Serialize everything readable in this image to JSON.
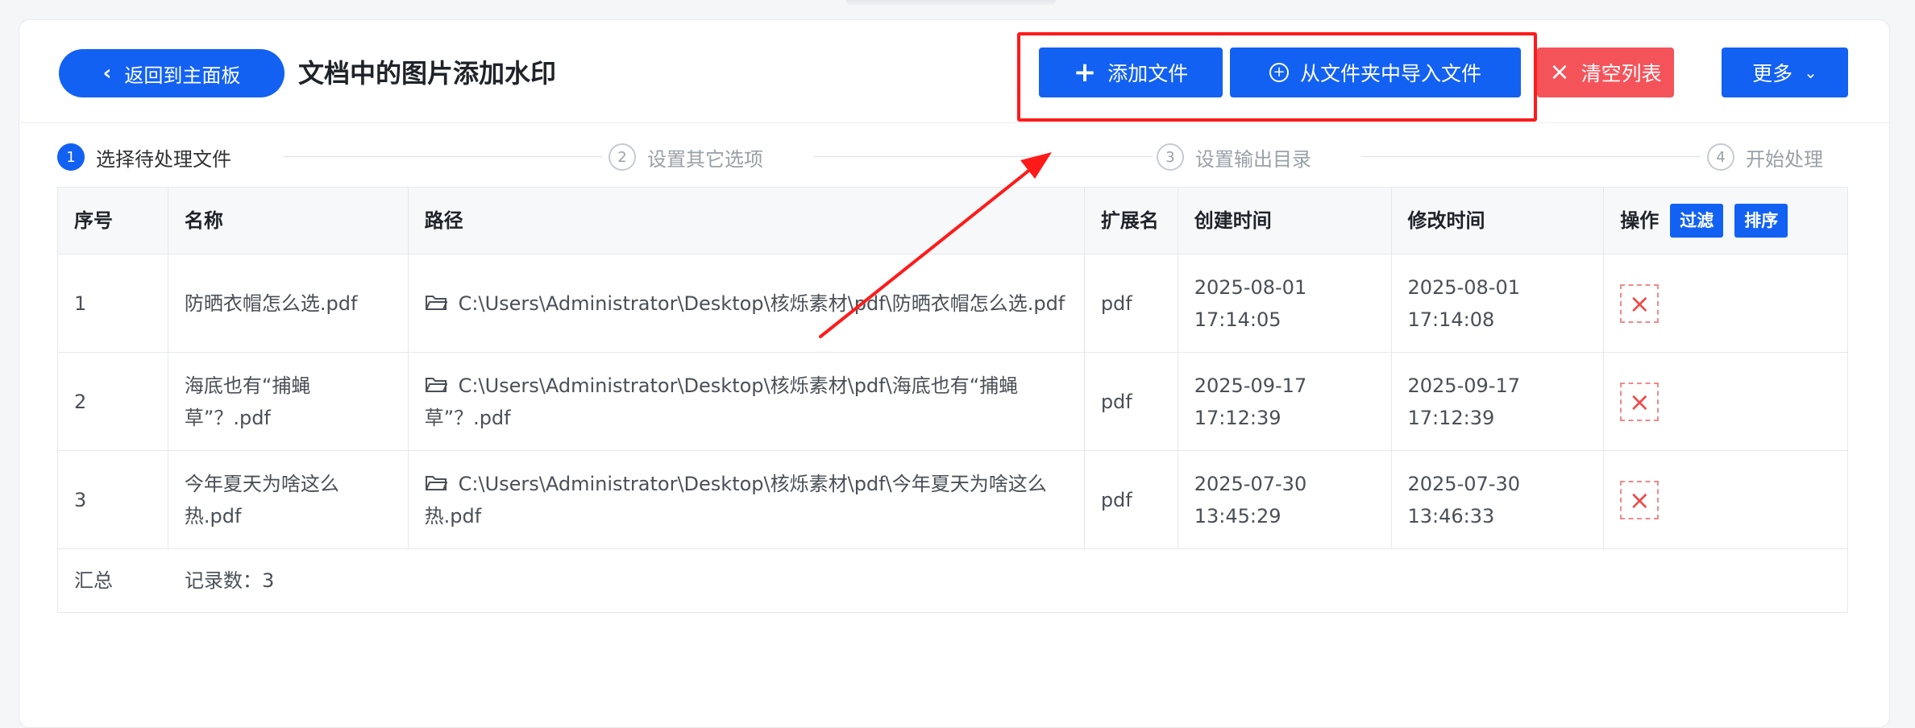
{
  "header": {
    "back_label": "返回到主面板",
    "title": "文档中的图片添加水印"
  },
  "toolbar": {
    "add_file": "添加文件",
    "import_folder": "从文件夹中导入文件",
    "clear_list": "清空列表",
    "more": "更多"
  },
  "steps": [
    {
      "num": "1",
      "label": "选择待处理文件"
    },
    {
      "num": "2",
      "label": "设置其它选项"
    },
    {
      "num": "3",
      "label": "设置输出目录"
    },
    {
      "num": "4",
      "label": "开始处理"
    }
  ],
  "table": {
    "columns": [
      "序号",
      "名称",
      "路径",
      "扩展名",
      "创建时间",
      "修改时间",
      "操作"
    ],
    "filter_label": "过滤",
    "sort_label": "排序",
    "rows": [
      {
        "index": "1",
        "name": "防晒衣帽怎么选.pdf",
        "path": "C:\\Users\\Administrator\\Desktop\\核烁素材\\pdf\\防晒衣帽怎么选.pdf",
        "ext": "pdf",
        "created": "2025-08-01 17:14:05",
        "modified": "2025-08-01 17:14:08"
      },
      {
        "index": "2",
        "name": "海底也有“捕蝇草”？.pdf",
        "path": "C:\\Users\\Administrator\\Desktop\\核烁素材\\pdf\\海底也有“捕蝇草”？.pdf",
        "ext": "pdf",
        "created": "2025-09-17 17:12:39",
        "modified": "2025-09-17 17:12:39"
      },
      {
        "index": "3",
        "name": "今年夏天为啥这么热.pdf",
        "path": "C:\\Users\\Administrator\\Desktop\\核烁素材\\pdf\\今年夏天为啥这么热.pdf",
        "ext": "pdf",
        "created": "2025-07-30 13:45:29",
        "modified": "2025-07-30 13:46:33"
      }
    ],
    "summary_label": "汇总",
    "record_count": "记录数：3"
  },
  "colors": {
    "primary": "#1261f2",
    "danger": "#f5535a",
    "annotation": "#ff1a1a"
  }
}
